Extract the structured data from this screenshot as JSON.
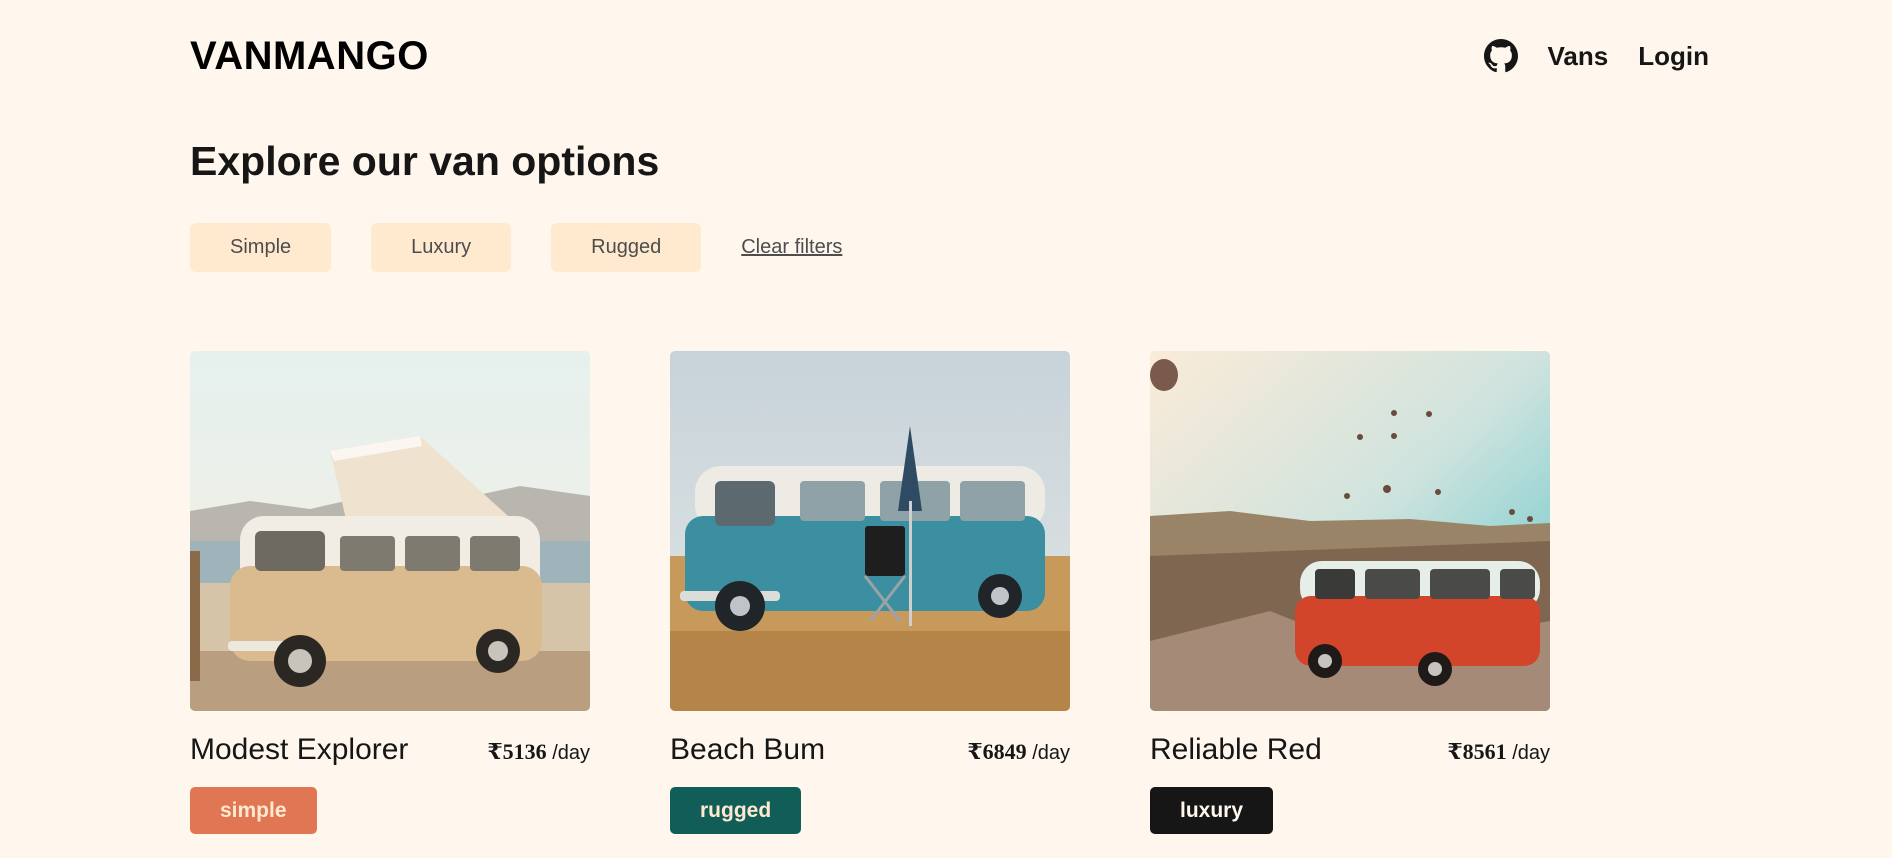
{
  "header": {
    "logo": "VANMANGO",
    "nav": [
      {
        "label": "Vans"
      },
      {
        "label": "Login"
      }
    ]
  },
  "title": "Explore our van options",
  "filters": {
    "buttons": [
      "Simple",
      "Luxury",
      "Rugged"
    ],
    "clear": "Clear filters"
  },
  "vans": [
    {
      "name": "Modest Explorer",
      "price": "₹5136",
      "unit": "/day",
      "type": "simple"
    },
    {
      "name": "Beach Bum",
      "price": "₹6849",
      "unit": "/day",
      "type": "rugged"
    },
    {
      "name": "Reliable Red",
      "price": "₹8561",
      "unit": "/day",
      "type": "luxury"
    }
  ],
  "colors": {
    "background": "#FFF7ED",
    "filter_bg": "#FFEAD0",
    "simple": "#E17654",
    "rugged": "#115E59",
    "luxury": "#161616"
  },
  "icons": {
    "github": "github-icon"
  }
}
